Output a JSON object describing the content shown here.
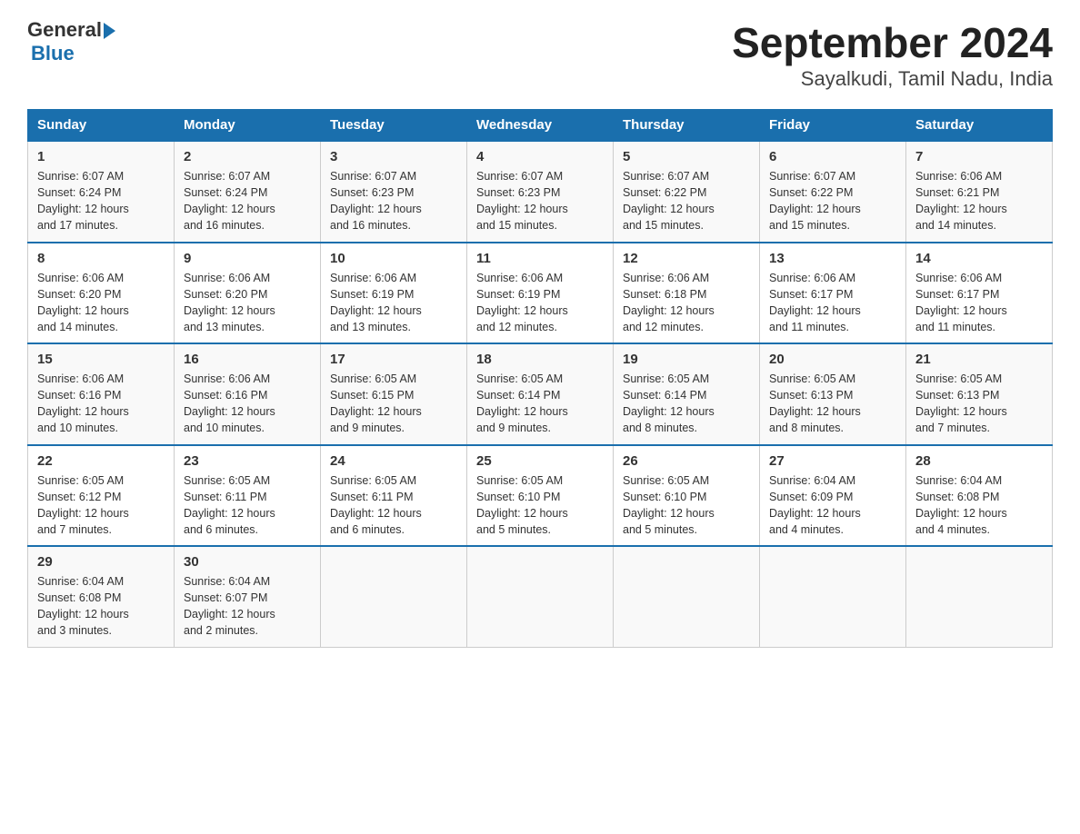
{
  "logo": {
    "general": "General",
    "blue": "Blue"
  },
  "title": "September 2024",
  "subtitle": "Sayalkudi, Tamil Nadu, India",
  "days_of_week": [
    "Sunday",
    "Monday",
    "Tuesday",
    "Wednesday",
    "Thursday",
    "Friday",
    "Saturday"
  ],
  "weeks": [
    [
      {
        "day": "1",
        "sunrise": "6:07 AM",
        "sunset": "6:24 PM",
        "daylight": "12 hours and 17 minutes."
      },
      {
        "day": "2",
        "sunrise": "6:07 AM",
        "sunset": "6:24 PM",
        "daylight": "12 hours and 16 minutes."
      },
      {
        "day": "3",
        "sunrise": "6:07 AM",
        "sunset": "6:23 PM",
        "daylight": "12 hours and 16 minutes."
      },
      {
        "day": "4",
        "sunrise": "6:07 AM",
        "sunset": "6:23 PM",
        "daylight": "12 hours and 15 minutes."
      },
      {
        "day": "5",
        "sunrise": "6:07 AM",
        "sunset": "6:22 PM",
        "daylight": "12 hours and 15 minutes."
      },
      {
        "day": "6",
        "sunrise": "6:07 AM",
        "sunset": "6:22 PM",
        "daylight": "12 hours and 15 minutes."
      },
      {
        "day": "7",
        "sunrise": "6:06 AM",
        "sunset": "6:21 PM",
        "daylight": "12 hours and 14 minutes."
      }
    ],
    [
      {
        "day": "8",
        "sunrise": "6:06 AM",
        "sunset": "6:20 PM",
        "daylight": "12 hours and 14 minutes."
      },
      {
        "day": "9",
        "sunrise": "6:06 AM",
        "sunset": "6:20 PM",
        "daylight": "12 hours and 13 minutes."
      },
      {
        "day": "10",
        "sunrise": "6:06 AM",
        "sunset": "6:19 PM",
        "daylight": "12 hours and 13 minutes."
      },
      {
        "day": "11",
        "sunrise": "6:06 AM",
        "sunset": "6:19 PM",
        "daylight": "12 hours and 12 minutes."
      },
      {
        "day": "12",
        "sunrise": "6:06 AM",
        "sunset": "6:18 PM",
        "daylight": "12 hours and 12 minutes."
      },
      {
        "day": "13",
        "sunrise": "6:06 AM",
        "sunset": "6:17 PM",
        "daylight": "12 hours and 11 minutes."
      },
      {
        "day": "14",
        "sunrise": "6:06 AM",
        "sunset": "6:17 PM",
        "daylight": "12 hours and 11 minutes."
      }
    ],
    [
      {
        "day": "15",
        "sunrise": "6:06 AM",
        "sunset": "6:16 PM",
        "daylight": "12 hours and 10 minutes."
      },
      {
        "day": "16",
        "sunrise": "6:06 AM",
        "sunset": "6:16 PM",
        "daylight": "12 hours and 10 minutes."
      },
      {
        "day": "17",
        "sunrise": "6:05 AM",
        "sunset": "6:15 PM",
        "daylight": "12 hours and 9 minutes."
      },
      {
        "day": "18",
        "sunrise": "6:05 AM",
        "sunset": "6:14 PM",
        "daylight": "12 hours and 9 minutes."
      },
      {
        "day": "19",
        "sunrise": "6:05 AM",
        "sunset": "6:14 PM",
        "daylight": "12 hours and 8 minutes."
      },
      {
        "day": "20",
        "sunrise": "6:05 AM",
        "sunset": "6:13 PM",
        "daylight": "12 hours and 8 minutes."
      },
      {
        "day": "21",
        "sunrise": "6:05 AM",
        "sunset": "6:13 PM",
        "daylight": "12 hours and 7 minutes."
      }
    ],
    [
      {
        "day": "22",
        "sunrise": "6:05 AM",
        "sunset": "6:12 PM",
        "daylight": "12 hours and 7 minutes."
      },
      {
        "day": "23",
        "sunrise": "6:05 AM",
        "sunset": "6:11 PM",
        "daylight": "12 hours and 6 minutes."
      },
      {
        "day": "24",
        "sunrise": "6:05 AM",
        "sunset": "6:11 PM",
        "daylight": "12 hours and 6 minutes."
      },
      {
        "day": "25",
        "sunrise": "6:05 AM",
        "sunset": "6:10 PM",
        "daylight": "12 hours and 5 minutes."
      },
      {
        "day": "26",
        "sunrise": "6:05 AM",
        "sunset": "6:10 PM",
        "daylight": "12 hours and 5 minutes."
      },
      {
        "day": "27",
        "sunrise": "6:04 AM",
        "sunset": "6:09 PM",
        "daylight": "12 hours and 4 minutes."
      },
      {
        "day": "28",
        "sunrise": "6:04 AM",
        "sunset": "6:08 PM",
        "daylight": "12 hours and 4 minutes."
      }
    ],
    [
      {
        "day": "29",
        "sunrise": "6:04 AM",
        "sunset": "6:08 PM",
        "daylight": "12 hours and 3 minutes."
      },
      {
        "day": "30",
        "sunrise": "6:04 AM",
        "sunset": "6:07 PM",
        "daylight": "12 hours and 2 minutes."
      },
      null,
      null,
      null,
      null,
      null
    ]
  ],
  "labels": {
    "sunrise": "Sunrise:",
    "sunset": "Sunset:",
    "daylight": "Daylight:"
  }
}
